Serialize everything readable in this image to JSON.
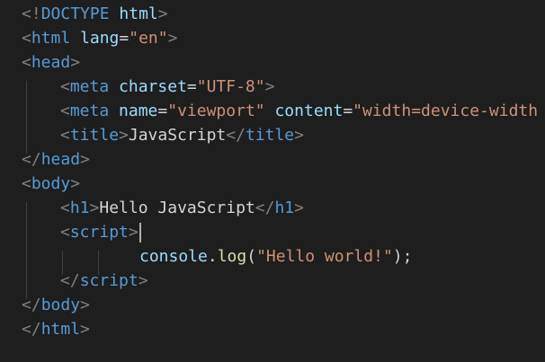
{
  "editor": {
    "language": "html",
    "colors": {
      "background": "#1e1e1e",
      "punctuation": "#808080",
      "tag": "#569cd6",
      "attribute": "#9cdcfe",
      "string": "#ce9178",
      "text": "#d4d4d4",
      "function": "#dcdcaa",
      "indent_guide": "#404040"
    },
    "lines": [
      {
        "doctype_open": "<!",
        "doctype_kw": "DOCTYPE",
        "doctype_space": " ",
        "doctype_name": "html",
        "doctype_close": ">"
      },
      {
        "lt": "<",
        "tag": "html",
        "sp": " ",
        "attr": "lang",
        "eq": "=",
        "val": "\"en\"",
        "gt": ">"
      },
      {
        "lt": "<",
        "tag": "head",
        "gt": ">"
      },
      {
        "lt": "<",
        "tag": "meta",
        "sp": " ",
        "attr": "charset",
        "eq": "=",
        "val": "\"UTF-8\"",
        "gt": ">"
      },
      {
        "lt": "<",
        "tag": "meta",
        "sp": " ",
        "attr1": "name",
        "eq1": "=",
        "val1": "\"viewport\"",
        "sp2": " ",
        "attr2": "content",
        "eq2": "=",
        "val2": "\"width=device-width"
      },
      {
        "lt": "<",
        "tag": "title",
        "gt": ">",
        "text": "JavaScript",
        "lt2": "</",
        "tag2": "title",
        "gt2": ">"
      },
      {
        "lt": "</",
        "tag": "head",
        "gt": ">"
      },
      {
        "lt": "<",
        "tag": "body",
        "gt": ">"
      },
      {
        "lt": "<",
        "tag": "h1",
        "gt": ">",
        "text": "Hello JavaScript",
        "lt2": "</",
        "tag2": "h1",
        "gt2": ">"
      },
      {
        "lt": "<",
        "tag": "script",
        "gt": ">"
      },
      {
        "obj": "console",
        "dot": ".",
        "fn": "log",
        "paren_open": "(",
        "str": "\"Hello world!\"",
        "paren_close": ");"
      },
      {
        "lt": "</",
        "tag": "script",
        "gt": ">"
      },
      {
        "lt": "</",
        "tag": "body",
        "gt": ">"
      },
      {
        "lt": "</",
        "tag": "html",
        "gt": ">"
      }
    ]
  }
}
